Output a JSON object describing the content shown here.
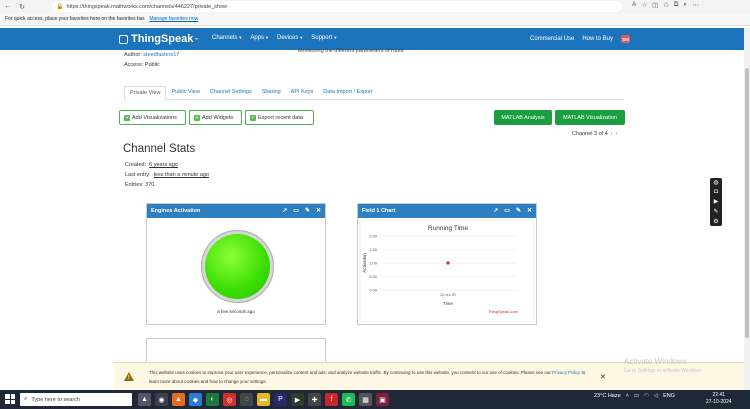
{
  "browser": {
    "url": "https://thingspeak.mathworks.com/channels/446227/private_show",
    "favorites_msg": "For quick access, place your favorites here on the favorites bar.",
    "favorites_link": "Manage favorites now"
  },
  "nav": {
    "logo": "ThingSpeak",
    "logo_tm": "™",
    "menu": [
      "Channels",
      "Apps",
      "Devices",
      "Support"
    ],
    "commercial": "Commercial Use",
    "howtobuy": "How to Buy",
    "avatar": "SM"
  },
  "channel": {
    "author_label": "Author:",
    "author": "steedfasters17",
    "access": "Access: Public",
    "description": "Monitoring the different parameters of robot"
  },
  "tabs": [
    "Private View",
    "Public View",
    "Channel Settings",
    "Sharing",
    "API Keys",
    "Data Import / Export"
  ],
  "buttons": {
    "add_viz": "Add Visualizations",
    "add_widgets": "Add Widgets",
    "export": "Export recent data",
    "matlab_analysis": "MATLAB Analysis",
    "matlab_viz": "MATLAB Visualization"
  },
  "pager": {
    "text": "Channel 3 of 4"
  },
  "stats": {
    "title": "Channel Stats",
    "created_label": "Created:",
    "created": "6 years ago",
    "last_label": "Last entry:",
    "last": "less than a minute ago",
    "entries": "Entries: 370"
  },
  "widget_engine": {
    "title": "Engines Activation",
    "time": "a few seconds ago",
    "lamp_color": "#39dd00"
  },
  "widget_field": {
    "title": "Field 1 Chart"
  },
  "chart_data": {
    "type": "scatter",
    "title": "Running Time",
    "xlabel": "Time",
    "ylabel": "Activation",
    "credit": "ThingSpeak.com",
    "x_ticks": [
      "22:41:20"
    ],
    "y_ticks": [
      0.0,
      0.5,
      1.0,
      1.5,
      2.0
    ],
    "y_tick_labels": [
      "0.00",
      "0.50",
      "1.00",
      "1.50",
      "2.00"
    ],
    "ylim": [
      0,
      2
    ],
    "series": [
      {
        "x": [
          "22:41:20"
        ],
        "y": [
          1.0
        ],
        "color": "#d62728"
      }
    ],
    "grid": true
  },
  "cookie": {
    "text": "This website uses cookies to improve your user experience, personalize content and ads, and analyze website traffic. By continuing to use this website, you consent to our use of cookies. Please see our",
    "link": "Privacy Policy",
    "text2": "to learn more about cookies and how to change your settings."
  },
  "activate": {
    "line1": "Activate Windows",
    "line2": "Go to Settings to activate Windows."
  },
  "taskbar": {
    "search": "Type here to search",
    "weather": "23°C  Haze",
    "lang": "ENG",
    "time": "22:41",
    "date": "27-10-2024"
  }
}
